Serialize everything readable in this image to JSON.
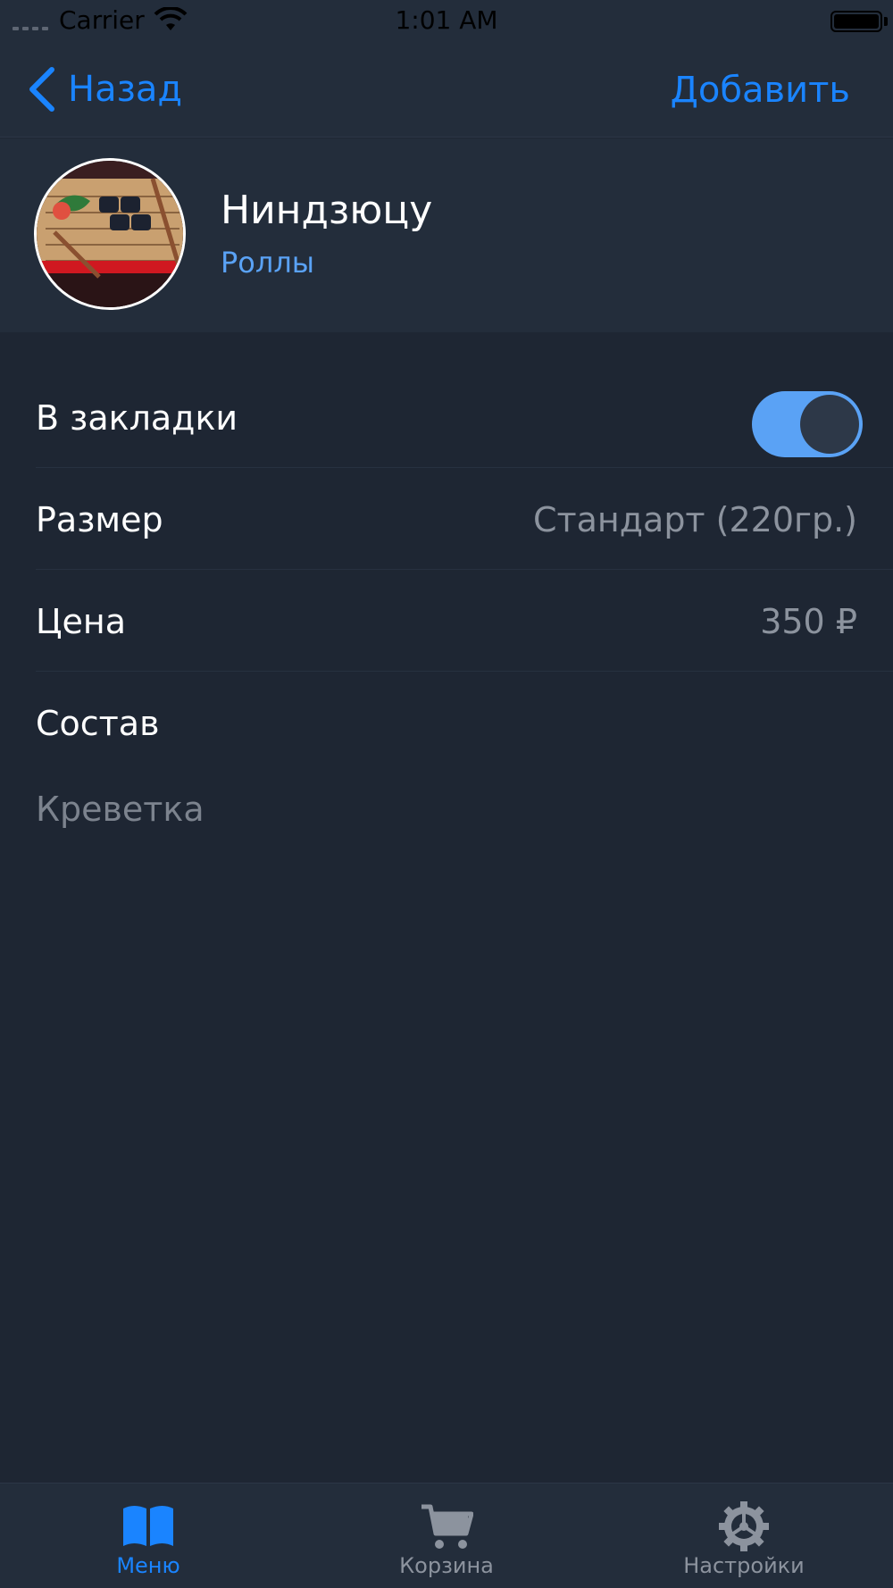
{
  "status_bar": {
    "carrier": "Carrier",
    "time": "1:01 AM"
  },
  "nav": {
    "back_label": "Назад",
    "add_label": "Добавить"
  },
  "product": {
    "title": "Ниндзюцу",
    "category": "Роллы"
  },
  "rows": {
    "bookmarks_label": "В закладки",
    "bookmarks_on": true,
    "size_label": "Размер",
    "size_value": "Стандарт (220гр.)",
    "price_label": "Цена",
    "price_value": "350 ₽",
    "composition_label": "Состав",
    "composition_value": "Креветка"
  },
  "tabs": {
    "menu_label": "Меню",
    "cart_label": "Корзина",
    "settings_label": "Настройки"
  },
  "colors": {
    "accent": "#1a84ff",
    "accent_light": "#5aa2f5",
    "background": "#1e2633",
    "bar_background": "#232d3b",
    "secondary_text": "#8c939e",
    "inactive_tab": "#8c939e"
  },
  "icons": {
    "back": "chevron-left-icon",
    "menu_tab": "book-icon",
    "cart_tab": "cart-icon",
    "settings_tab": "gear-icon"
  }
}
